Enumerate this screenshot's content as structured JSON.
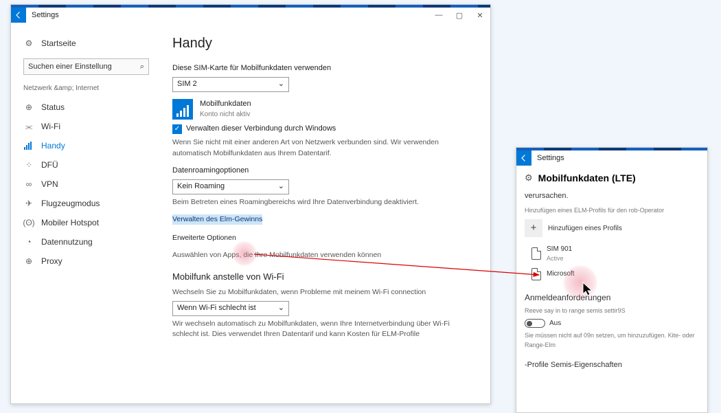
{
  "window1": {
    "title": "Settings",
    "sidebar": {
      "home": "Startseite",
      "search_placeholder": "Suchen einer Einstellung",
      "section": "Netzwerk &amp; Internet",
      "items": [
        {
          "icon": "⊕",
          "label": "Status",
          "selected": false
        },
        {
          "icon": "⫘",
          "label": "Wi-Fi",
          "selected": false
        },
        {
          "icon": "▫",
          "label": "Handy",
          "selected": true
        },
        {
          "icon": "⁘",
          "label": "DFÜ",
          "selected": false
        },
        {
          "icon": "∞",
          "label": "VPN",
          "selected": false
        },
        {
          "icon": "✈",
          "label": "Flugzeugmodus",
          "selected": false
        },
        {
          "icon": "(ʘ)",
          "label": "Mobiler Hotspot",
          "selected": false
        },
        {
          "icon": "◔",
          "label": "Datennutzung",
          "selected": false
        },
        {
          "icon": "⊕",
          "label": "Proxy",
          "selected": false
        }
      ]
    },
    "content": {
      "heading": "Handy",
      "sim_label": "Diese SIM-Karte für Mobilfunkdaten verwenden",
      "sim_value": "SIM 2",
      "tile_title": "Mobilfunkdaten",
      "tile_sub": "Konto nicht aktiv",
      "checkbox": "Verwalten dieser Verbindung durch Windows",
      "body1": "Wenn Sie nicht mit einer anderen Art von Netzwerk verbunden sind. Wir verwenden automatisch Mobilfunkdaten aus Ihrem Datentarif.",
      "roam_label": "Datenroamingoptionen",
      "roam_value": "Kein Roaming",
      "body2": "Beim Betreten eines Roamingbereichs wird Ihre Datenverbindung deaktiviert.",
      "link1": "Verwalten des Elm-Gewinns",
      "link2": "Erweiterte Optionen",
      "link3": "Auswählen von Apps, die Ihre Mobilfunkdaten verwenden können",
      "wifi_heading": "Mobilfunk anstelle von Wi-Fi",
      "wifi_body1": "Wechseln Sie zu Mobilfunkdaten, wenn Probleme mit meinem Wi-Fi connection",
      "wifi_value": "Wenn Wi-Fi schlecht ist",
      "wifi_body2": "Wir wechseln automatisch zu Mobilfunkdaten, wenn Ihre Internetverbindung über Wi-Fi schlecht ist. Dies verwendet Ihren Datentarif und kann Kosten für ELM-Profile"
    }
  },
  "window2": {
    "title": "Settings",
    "heading": "Mobilfunkdaten (LTE)",
    "body_top": "verursachen.",
    "hint": "Hinzufügen eines ELM-Profils für den rob-Operator",
    "add": "Hinzufügen eines Profils",
    "items": [
      {
        "name": "SIM 901",
        "sub": "Active"
      },
      {
        "name": "Microsoft",
        "sub": ""
      }
    ],
    "req_heading": "Anmeldeanforderungen",
    "req_body": "Reeve say in to range semis settir9S",
    "toggle": "Aus",
    "req_body2": "Sie müssen nicht auf 09n setzen, um hinzuzufügen. Kite- oder Range-Elm",
    "profile_heading": "-Profile Semis-Eigenschaften"
  }
}
